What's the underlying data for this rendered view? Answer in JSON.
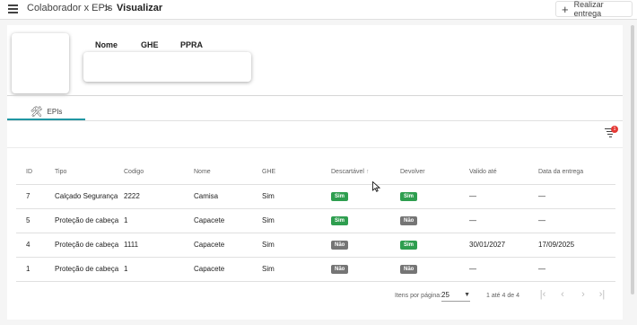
{
  "header": {
    "breadcrumb_parent": "Colaborador x EPIs",
    "breadcrumb_sep": ">",
    "breadcrumb_current": "Visualizar",
    "deliver_plus": "+",
    "deliver_label": "Realizar entrega"
  },
  "profile": {
    "label_nome": "Nome",
    "label_ghe": "GHE",
    "label_ppra": "PPRA"
  },
  "tabs": [
    {
      "icon": "tools-icon",
      "label": "EPIs"
    }
  ],
  "filter": {
    "badge": "1"
  },
  "table": {
    "columns": [
      "ID",
      "Tipo",
      "Codigo",
      "Nome",
      "GHE",
      "Descartável",
      "Devolver",
      "Valido até",
      "Data da entrega"
    ],
    "sort_arrow": "↑",
    "rows": [
      {
        "id": "7",
        "tipo": "Calçado Segurança",
        "codigo": "2222",
        "nome": "Camisa",
        "ghe": "Sim",
        "descartavel": "Sim",
        "devolver": "Sim",
        "valido": "—",
        "entrega": "—"
      },
      {
        "id": "5",
        "tipo": "Proteção de cabeça",
        "codigo": "1",
        "nome": "Capacete",
        "ghe": "Sim",
        "descartavel": "Sim",
        "devolver": "Não",
        "valido": "—",
        "entrega": "—"
      },
      {
        "id": "4",
        "tipo": "Proteção de cabeça",
        "codigo": "1111",
        "nome": "Capacete",
        "ghe": "Sim",
        "descartavel": "Não",
        "devolver": "Sim",
        "valido": "30/01/2027",
        "entrega": "17/09/2025"
      },
      {
        "id": "1",
        "tipo": "Proteção de cabeça",
        "codigo": "1",
        "nome": "Capacete",
        "ghe": "Sim",
        "descartavel": "Não",
        "devolver": "Não",
        "valido": "—",
        "entrega": "—"
      }
    ]
  },
  "pagination": {
    "items_per_page_label": "Itens por página:",
    "items_per_page_value": "25",
    "range": "1 até 4 de 4",
    "first": "|‹",
    "prev": "‹",
    "next": "›",
    "last": "›|"
  },
  "colors": {
    "sim": "#2e9e4f",
    "nao": "#757575",
    "tab_accent": "#2196a3",
    "badge": "#e53935"
  }
}
